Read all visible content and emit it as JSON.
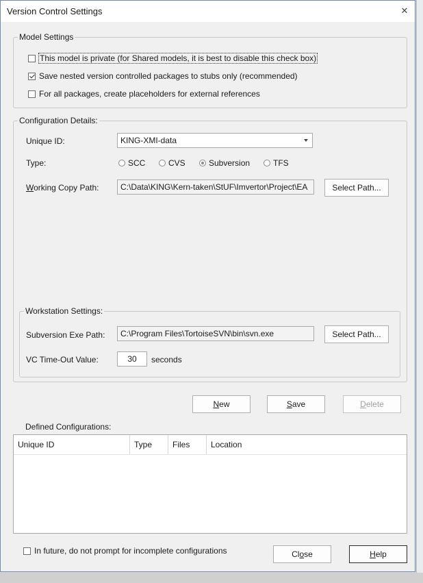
{
  "window": {
    "title": "Version Control Settings"
  },
  "model_settings": {
    "legend": "Model Settings",
    "private": {
      "label": "This model is private (for Shared models, it is best to disable this check box)",
      "checked": false
    },
    "nested": {
      "label": "Save nested version controlled packages to stubs only (recommended)",
      "checked": true
    },
    "placeholders": {
      "label": "For all packages, create placeholders for external references",
      "checked": false
    }
  },
  "config": {
    "legend": "Configuration Details:",
    "unique_id_label": "Unique ID:",
    "unique_id_value": "KING-XMI-data",
    "type_label": "Type:",
    "types": [
      "SCC",
      "CVS",
      "Subversion",
      "TFS"
    ],
    "selected_type": "Subversion",
    "working_copy_label_u": "W",
    "working_copy_label_rest": "orking Copy Path:",
    "working_copy_value": "C:\\Data\\KING\\Kern-taken\\StUF\\Imvertor\\Project\\EA",
    "select_path_label": "Select Path..."
  },
  "workstation": {
    "legend": "Workstation Settings:",
    "exe_label": "Subversion Exe Path:",
    "exe_value": "C:\\Program Files\\TortoiseSVN\\bin\\svn.exe",
    "select_path_label": "Select Path...",
    "timeout_label": "VC Time-Out Value:",
    "timeout_value": "30",
    "timeout_unit": "seconds"
  },
  "actions": {
    "new_u": "N",
    "new_rest": "ew",
    "save_u": "S",
    "save_rest": "ave",
    "delete_u": "D",
    "delete_rest": "elete"
  },
  "defined": {
    "label": "Defined Configurations:",
    "columns": [
      "Unique ID",
      "Type",
      "Files",
      "Location"
    ]
  },
  "footer": {
    "no_prompt_label": "In future, do not prompt for incomplete configurations",
    "close_pre": "Cl",
    "close_u": "o",
    "close_post": "se",
    "help_u": "H",
    "help_rest": "elp"
  }
}
